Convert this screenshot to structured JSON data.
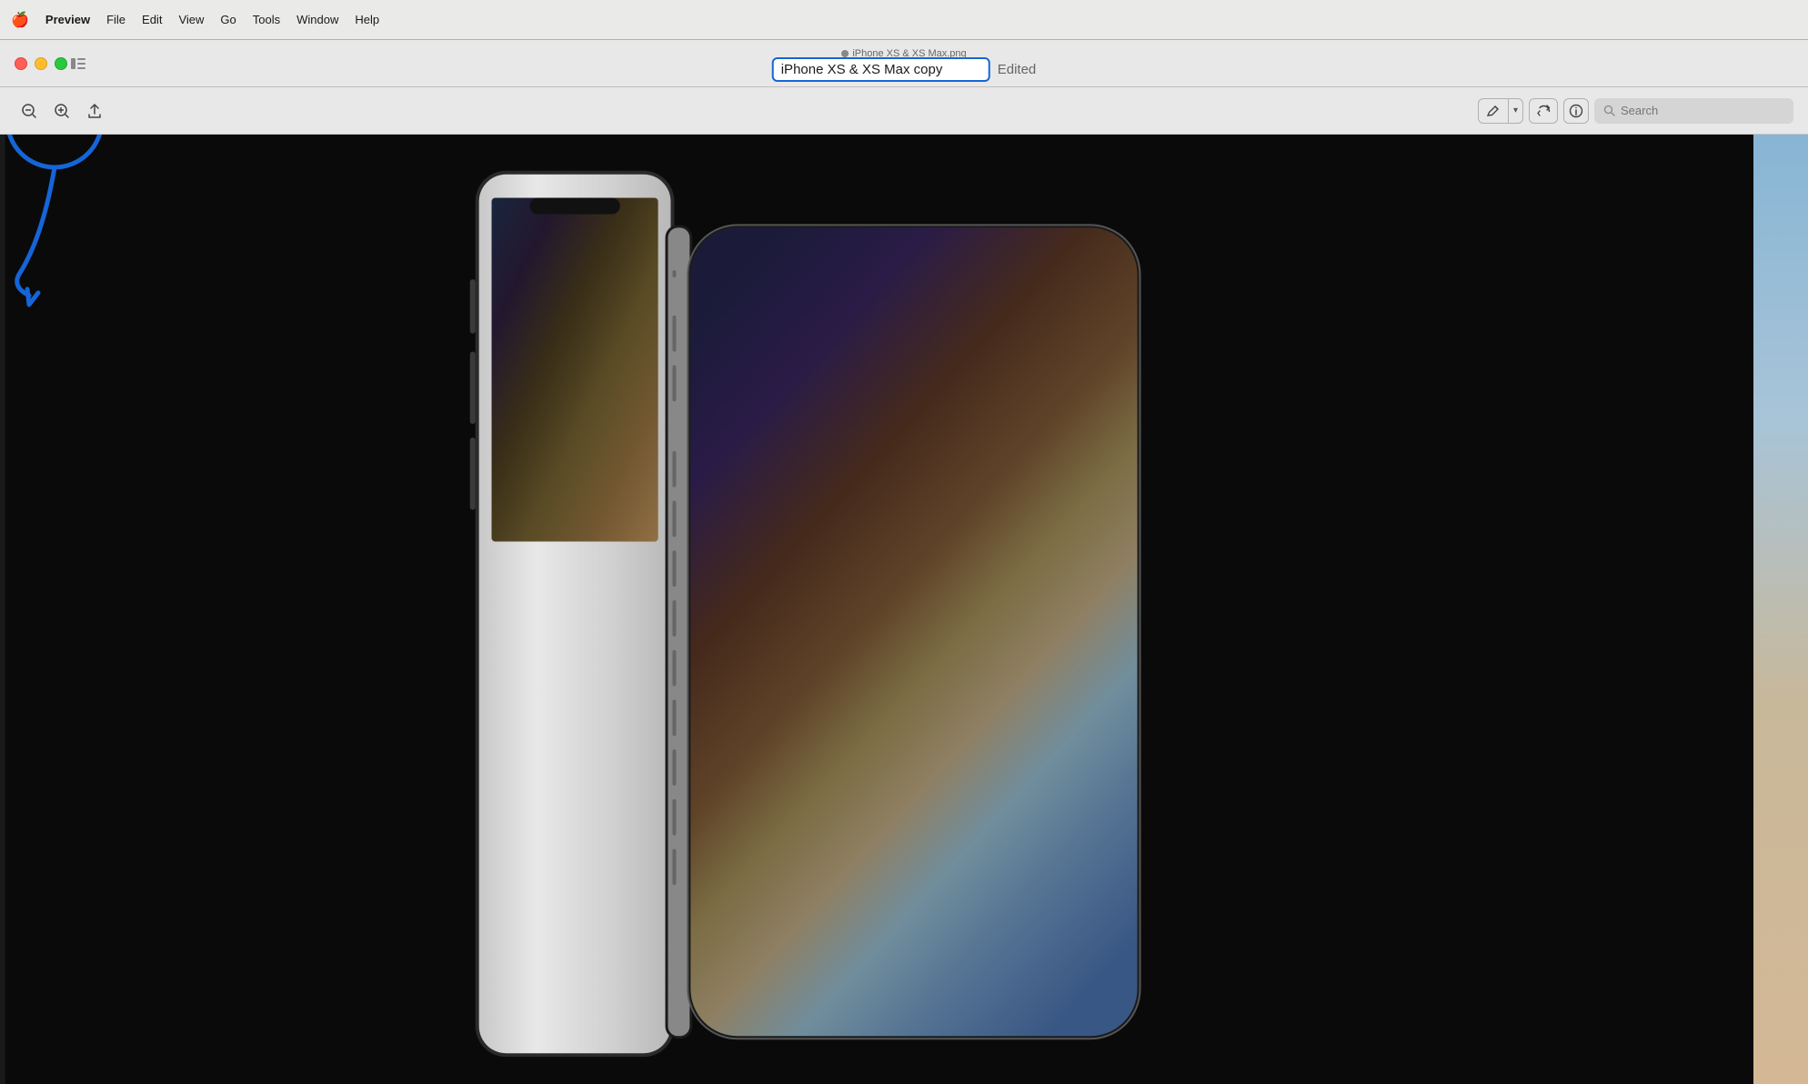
{
  "menubar": {
    "apple_symbol": "🍎",
    "items": [
      {
        "label": "Preview",
        "name": "preview-menu"
      },
      {
        "label": "File",
        "name": "file-menu"
      },
      {
        "label": "Edit",
        "name": "edit-menu"
      },
      {
        "label": "View",
        "name": "view-menu"
      },
      {
        "label": "Go",
        "name": "go-menu"
      },
      {
        "label": "Tools",
        "name": "tools-menu"
      },
      {
        "label": "Window",
        "name": "window-menu"
      },
      {
        "label": "Help",
        "name": "help-menu"
      }
    ]
  },
  "titlebar": {
    "file_tab_name": "iPhone XS & XS Max.png",
    "title_input_value": "iPhone XS & XS Max copy",
    "edited_label": "Edited"
  },
  "toolbar": {
    "zoom_out_icon": "−",
    "zoom_in_icon": "+",
    "share_icon": "⬆",
    "markup_label": "✏️",
    "rotate_icon": "↻",
    "info_icon": "ⓘ",
    "search_placeholder": "Search",
    "search_icon": "🔍"
  },
  "colors": {
    "blue_annotation": "#1565d8",
    "traffic_close": "#ff5f57",
    "traffic_minimize": "#ffbd2e",
    "traffic_maximize": "#28c940"
  },
  "annotation": {
    "circle_label": "traffic lights circle",
    "arrow_label": "pointing arrow"
  }
}
